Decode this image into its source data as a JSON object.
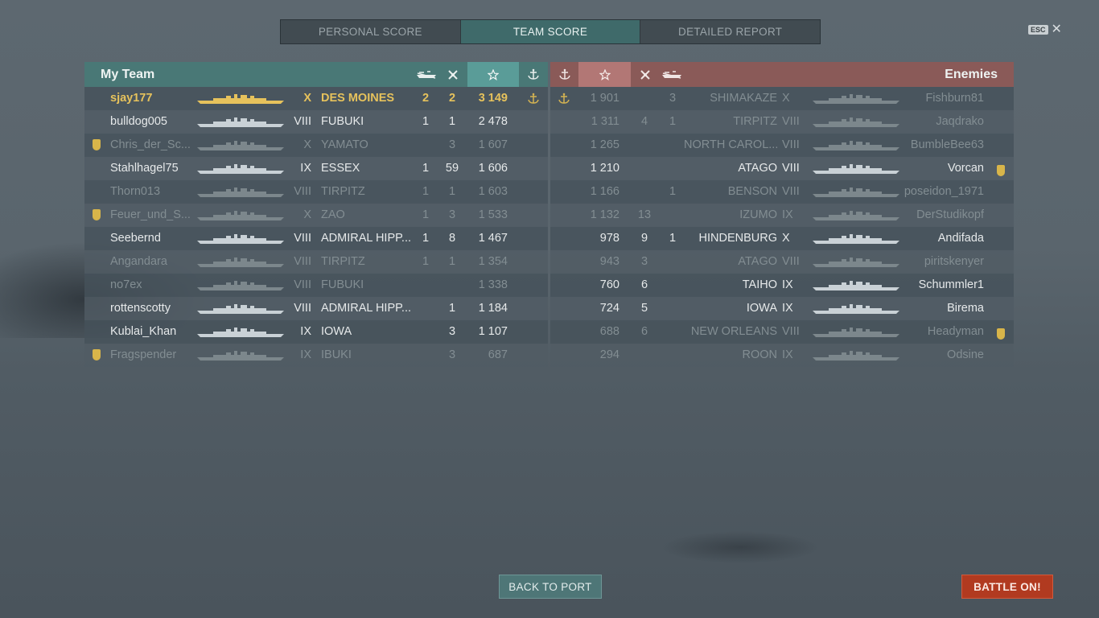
{
  "tabs": [
    {
      "label": "PERSONAL SCORE",
      "active": false
    },
    {
      "label": "TEAM SCORE",
      "active": true
    },
    {
      "label": "DETAILED REPORT",
      "active": false
    }
  ],
  "esc": {
    "key": "ESC",
    "close": "✕"
  },
  "my_team": {
    "title": "My Team",
    "players": [
      {
        "name": "sjay177",
        "tier": "X",
        "ship": "DES MOINES",
        "c1": "2",
        "c2": "2",
        "score": "3 149",
        "me": true,
        "alive": true,
        "badge": false,
        "anchor": true
      },
      {
        "name": "bulldog005",
        "tier": "VIII",
        "ship": "FUBUKI",
        "c1": "1",
        "c2": "1",
        "score": "2 478",
        "alive": true,
        "badge": false
      },
      {
        "name": "Chris_der_Sc...",
        "tier": "X",
        "ship": "YAMATO",
        "c1": "",
        "c2": "3",
        "score": "1 607",
        "alive": false,
        "badge": true
      },
      {
        "name": "Stahlhagel75",
        "tier": "IX",
        "ship": "ESSEX",
        "c1": "1",
        "c2": "59",
        "score": "1 606",
        "alive": true,
        "badge": false
      },
      {
        "name": "Thorn013",
        "tier": "VIII",
        "ship": "TIRPITZ",
        "c1": "1",
        "c2": "1",
        "score": "1 603",
        "alive": false,
        "badge": false
      },
      {
        "name": "Feuer_und_S...",
        "tier": "X",
        "ship": "ZAO",
        "c1": "1",
        "c2": "3",
        "score": "1 533",
        "alive": false,
        "badge": true
      },
      {
        "name": "Seebernd",
        "tier": "VIII",
        "ship": "ADMIRAL HIPP...",
        "c1": "1",
        "c2": "8",
        "score": "1 467",
        "alive": true,
        "badge": false
      },
      {
        "name": "Angandara",
        "tier": "VIII",
        "ship": "TIRPITZ",
        "c1": "1",
        "c2": "1",
        "score": "1 354",
        "alive": false,
        "badge": false
      },
      {
        "name": "no7ex",
        "tier": "VIII",
        "ship": "FUBUKI",
        "c1": "",
        "c2": "",
        "score": "1 338",
        "alive": false,
        "badge": false
      },
      {
        "name": "rottenscotty",
        "tier": "VIII",
        "ship": "ADMIRAL HIPP...",
        "c1": "",
        "c2": "1",
        "score": "1 184",
        "alive": true,
        "badge": false
      },
      {
        "name": "Kublai_Khan",
        "tier": "IX",
        "ship": "IOWA",
        "c1": "",
        "c2": "3",
        "score": "1 107",
        "alive": true,
        "badge": false
      },
      {
        "name": "Fragspender",
        "tier": "IX",
        "ship": "IBUKI",
        "c1": "",
        "c2": "3",
        "score": "687",
        "alive": false,
        "badge": true
      }
    ]
  },
  "enemies": {
    "title": "Enemies",
    "players": [
      {
        "score": "1 901",
        "c2": "",
        "c1": "3",
        "ship": "SHIMAKAZE",
        "tier": "X",
        "name": "Fishburn81",
        "alive": false,
        "badge": false,
        "anchor": true
      },
      {
        "score": "1 311",
        "c2": "4",
        "c1": "1",
        "ship": "TIRPITZ",
        "tier": "VIII",
        "name": "Jaqdrako",
        "alive": false,
        "badge": false
      },
      {
        "score": "1 265",
        "c2": "",
        "c1": "",
        "ship": "NORTH CAROL...",
        "tier": "VIII",
        "name": "BumbleBee63",
        "alive": false,
        "badge": false
      },
      {
        "score": "1 210",
        "c2": "",
        "c1": "",
        "ship": "ATAGO",
        "tier": "VIII",
        "name": "Vorcan",
        "alive": true,
        "badge": true
      },
      {
        "score": "1 166",
        "c2": "",
        "c1": "1",
        "ship": "BENSON",
        "tier": "VIII",
        "name": "poseidon_1971",
        "alive": false,
        "badge": false
      },
      {
        "score": "1 132",
        "c2": "13",
        "c1": "",
        "ship": "IZUMO",
        "tier": "IX",
        "name": "DerStudikopf",
        "alive": false,
        "badge": false
      },
      {
        "score": "978",
        "c2": "9",
        "c1": "1",
        "ship": "HINDENBURG",
        "tier": "X",
        "name": "Andifada",
        "alive": true,
        "badge": false
      },
      {
        "score": "943",
        "c2": "3",
        "c1": "",
        "ship": "ATAGO",
        "tier": "VIII",
        "name": "piritskenyer",
        "alive": false,
        "badge": false
      },
      {
        "score": "760",
        "c2": "6",
        "c1": "",
        "ship": "TAIHO",
        "tier": "IX",
        "name": "Schummler1",
        "alive": true,
        "badge": false
      },
      {
        "score": "724",
        "c2": "5",
        "c1": "",
        "ship": "IOWA",
        "tier": "IX",
        "name": "Birema",
        "alive": true,
        "badge": false
      },
      {
        "score": "688",
        "c2": "6",
        "c1": "",
        "ship": "NEW ORLEANS",
        "tier": "VIII",
        "name": "Headyman",
        "alive": false,
        "badge": true
      },
      {
        "score": "294",
        "c2": "",
        "c1": "",
        "ship": "ROON",
        "tier": "IX",
        "name": "Odsine",
        "alive": false,
        "badge": false
      }
    ]
  },
  "buttons": {
    "back": "BACK TO PORT",
    "battle": "BATTLE ON!"
  },
  "colors": {
    "my_team_header": "#497876",
    "enemy_header": "#8a5a58",
    "self_highlight": "#e6c25c",
    "battle_button": "#b13a20"
  }
}
